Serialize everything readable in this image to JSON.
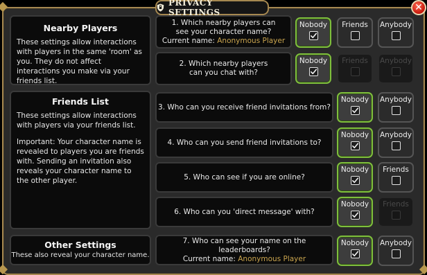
{
  "window": {
    "title": "PRIVACY SETTINGS",
    "close_glyph": "✕"
  },
  "colors": {
    "frame": "#a68850",
    "selected_border": "#7fbf3d",
    "accent_gold": "#c9a44e"
  },
  "sections": {
    "nearby": {
      "title": "Nearby Players",
      "desc": "These settings allow interactions with players in the same 'room' as you. They do not affect interactions you make via your friends list."
    },
    "friends": {
      "title": "Friends List",
      "desc1": "These settings allow interactions with players via your friends list.",
      "desc2": "Important: Your character name is revealed to players you are friends with. Sending an invitation also reveals your character name to the other player."
    },
    "other": {
      "title": "Other Settings",
      "desc": "These also reveal your character name."
    }
  },
  "questions": {
    "q1": {
      "text": "1. Which nearby players can see your character name?",
      "current_label": "Current name:",
      "current_value": "Anonymous Player",
      "options": [
        {
          "label": "Nobody",
          "checked": true,
          "enabled": true
        },
        {
          "label": "Friends",
          "checked": false,
          "enabled": true
        },
        {
          "label": "Anybody",
          "checked": false,
          "enabled": true
        }
      ]
    },
    "q2": {
      "line1": "2. Which nearby players",
      "line2": "can you chat with?",
      "options": [
        {
          "label": "Nobody",
          "checked": true,
          "enabled": true
        },
        {
          "label": "Friends",
          "checked": false,
          "enabled": false
        },
        {
          "label": "Anybody",
          "checked": false,
          "enabled": false
        }
      ]
    },
    "q3": {
      "text": "3. Who can you receive friend invitations from?",
      "options": [
        {
          "label": "Nobody",
          "checked": true,
          "enabled": true
        },
        {
          "label": "Anybody",
          "checked": false,
          "enabled": true
        }
      ]
    },
    "q4": {
      "text": "4. Who can you send friend invitations to?",
      "options": [
        {
          "label": "Nobody",
          "checked": true,
          "enabled": true
        },
        {
          "label": "Anybody",
          "checked": false,
          "enabled": true
        }
      ]
    },
    "q5": {
      "text": "5. Who can see if you are online?",
      "options": [
        {
          "label": "Nobody",
          "checked": true,
          "enabled": true
        },
        {
          "label": "Friends",
          "checked": false,
          "enabled": true
        }
      ]
    },
    "q6": {
      "text": "6. Who can you 'direct message' with?",
      "options": [
        {
          "label": "Nobody",
          "checked": true,
          "enabled": true
        },
        {
          "label": "Friends",
          "checked": false,
          "enabled": false
        }
      ]
    },
    "q7": {
      "text": "7. Who can see your name on the leaderboards?",
      "current_label": "Current name:",
      "current_value": "Anonymous Player",
      "options": [
        {
          "label": "Nobody",
          "checked": true,
          "enabled": true
        },
        {
          "label": "Anybody",
          "checked": false,
          "enabled": true
        }
      ]
    }
  }
}
